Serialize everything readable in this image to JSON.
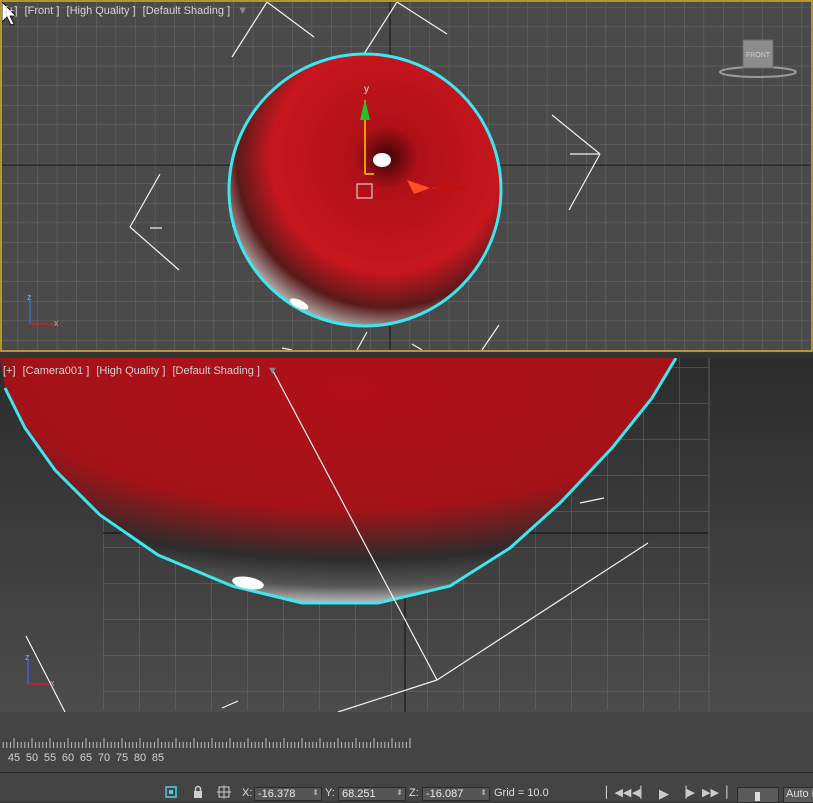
{
  "front_viewport": {
    "labels": [
      "[+]",
      "[Front ]",
      "[High Quality ]",
      "[Default Shading ]"
    ],
    "viewcube_label": "FRONT",
    "axis_labels": {
      "vertical": "z",
      "horizontal": "x"
    },
    "gizmo_axis_label": "y"
  },
  "camera_viewport": {
    "labels": [
      "[+]",
      "[Camera001 ]",
      "[High Quality ]",
      "[Default Shading ]"
    ],
    "axis_labels": {
      "vertical": "z",
      "horizontal": "x"
    }
  },
  "timeline": {
    "ticks": [
      "45",
      "50",
      "55",
      "60",
      "65",
      "70",
      "75",
      "80",
      "85"
    ]
  },
  "statusbar": {
    "x_label": "X:",
    "x_value": "-16.378",
    "y_label": "Y:",
    "y_value": "68.251",
    "z_label": "Z:",
    "z_value": "-16.087",
    "grid": "Grid = 10.0",
    "auto_key": "Auto K"
  },
  "icons": {
    "filter": "funnel-icon",
    "selection_lock": "lock-icon",
    "isolate": "isolate-icon",
    "transform": "transform-mode-icon",
    "playback": [
      "goto-start-icon",
      "prev-frame-icon",
      "play-icon",
      "next-frame-icon",
      "goto-end-icon"
    ]
  },
  "colors": {
    "selection_outline": "#3ee6f0",
    "sphere_red": "#c0141c",
    "viewport_active_border": "#b8952c",
    "gizmo_y": "#2bbd2b",
    "gizmo_x": "#d01818"
  }
}
